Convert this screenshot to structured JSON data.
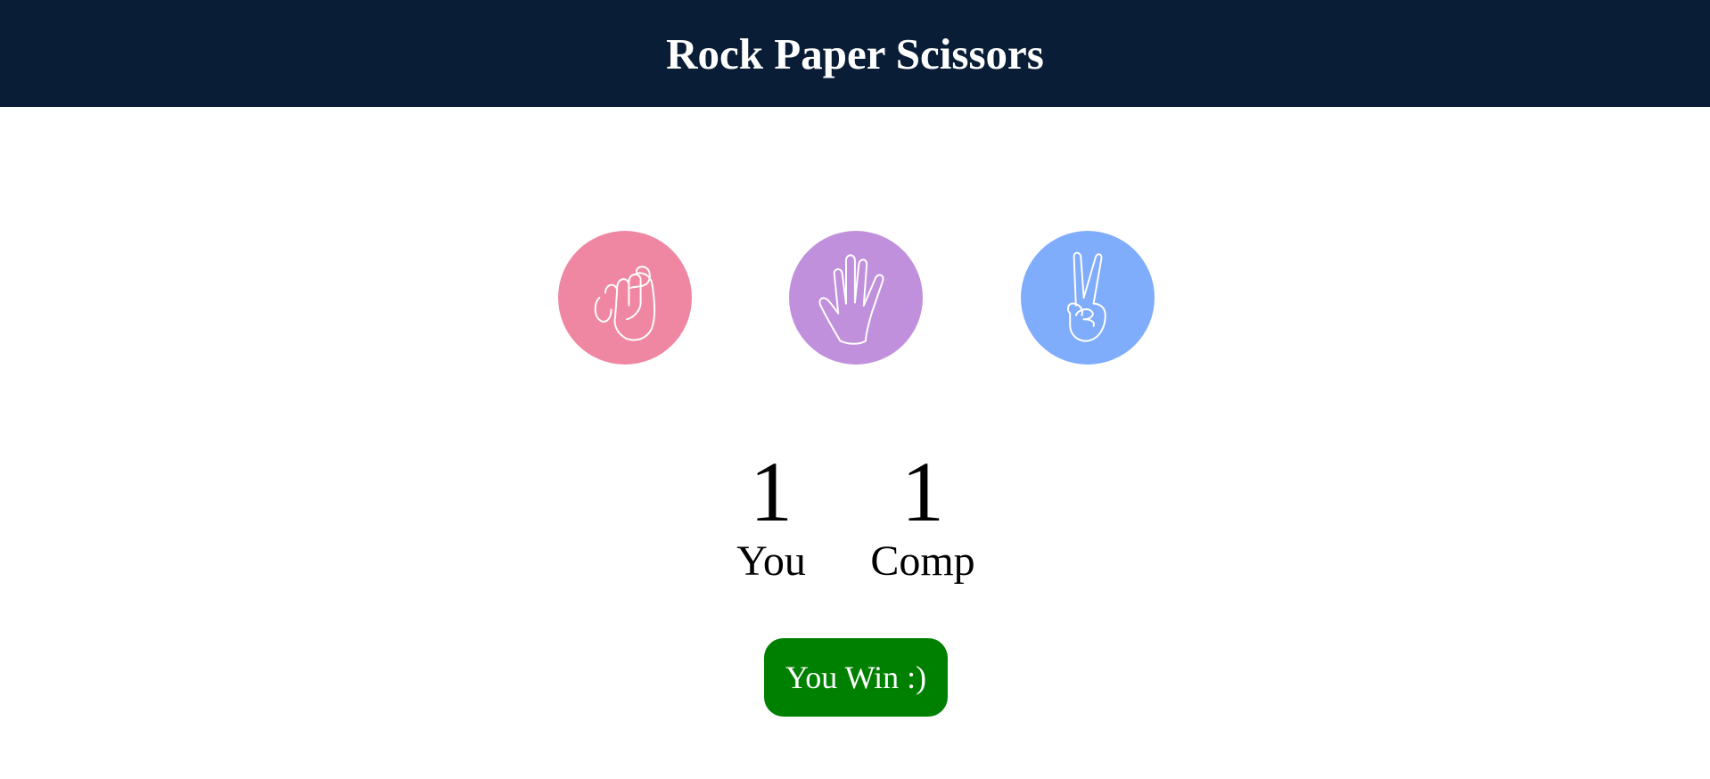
{
  "header": {
    "title": "Rock Paper Scissors"
  },
  "choices": [
    {
      "id": "rock",
      "icon": "rock-hand-icon",
      "color": "#f087a2"
    },
    {
      "id": "paper",
      "icon": "paper-hand-icon",
      "color": "#c190dc"
    },
    {
      "id": "scissors",
      "icon": "scissors-hand-icon",
      "color": "#80acfc"
    }
  ],
  "scores": {
    "user": {
      "value": "1",
      "label": "You"
    },
    "computer": {
      "value": "1",
      "label": "Comp"
    }
  },
  "result": {
    "message": "You Win :)",
    "color": "#008000"
  },
  "colors": {
    "header_bg": "#0a1d36"
  }
}
